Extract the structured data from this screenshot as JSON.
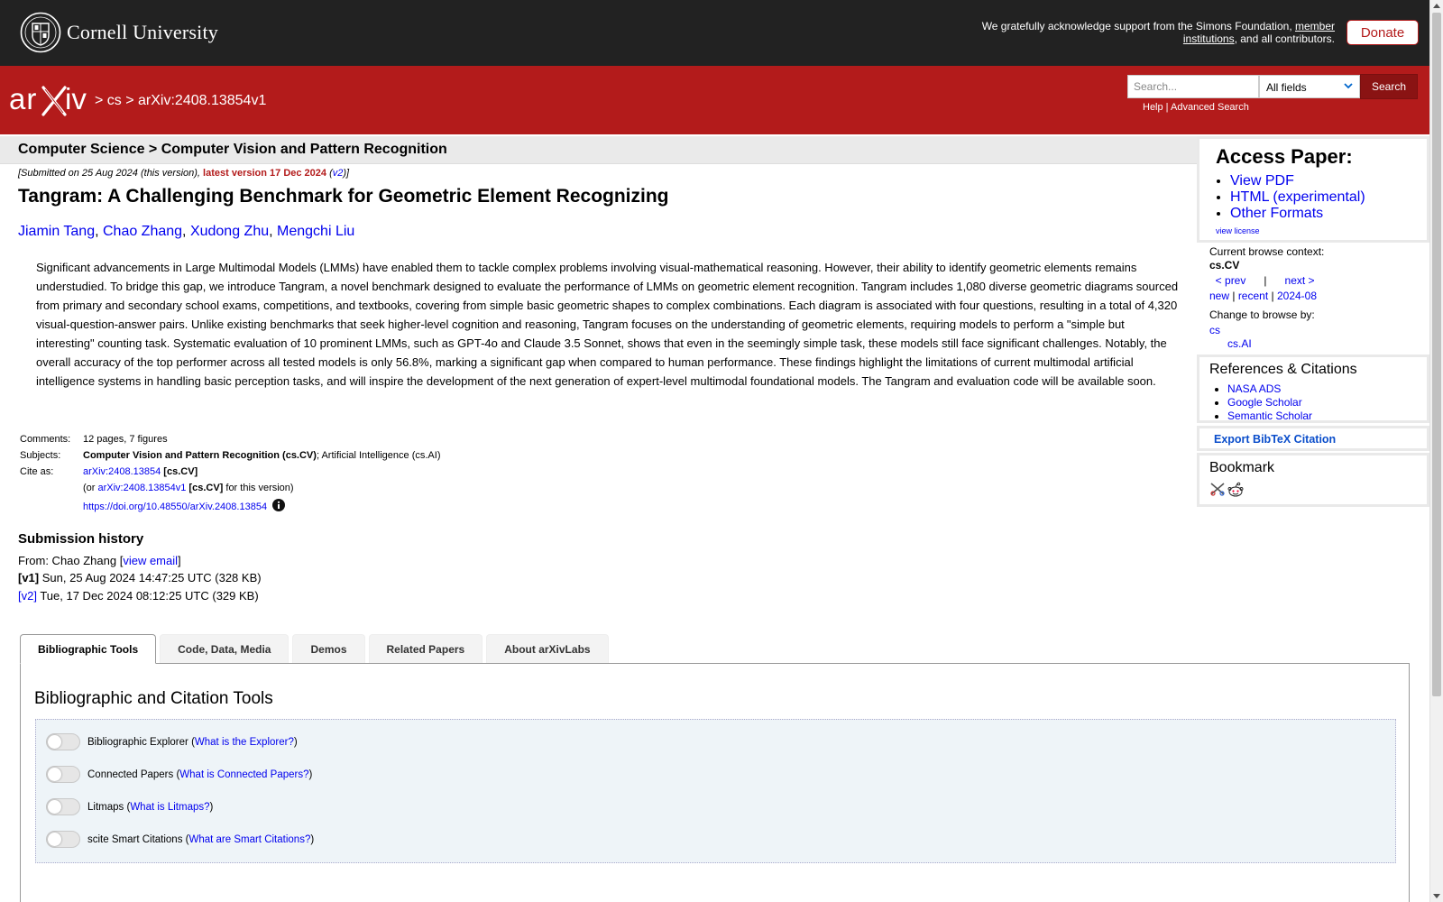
{
  "top": {
    "university": "Cornell University",
    "ack_prefix": "We gratefully acknowledge support from the Simons Foundation, ",
    "ack_link1": "member",
    "ack_link2": "institutions",
    "ack_suffix": ", and all contributors.",
    "donate": "Donate"
  },
  "header": {
    "crumbs": "> cs > arXiv:2408.13854v1",
    "search_placeholder": "Search...",
    "search_field": "All fields",
    "search_button": "Search",
    "help": "Help",
    "sep": " | ",
    "advanced": "Advanced Search"
  },
  "subject_header": "Computer Science > Computer Vision and Pattern Recognition",
  "paper": {
    "submitted_prefix": "[Submitted on 25 Aug 2024 (this version), ",
    "latest": "latest version 17 Dec 2024",
    "v2_open": " (",
    "v2": "v2",
    "v2_close": ")]",
    "title": "Tangram: A Challenging Benchmark for Geometric Element Recognizing",
    "authors": [
      "Jiamin Tang",
      "Chao Zhang",
      "Xudong Zhu",
      "Mengchi Liu"
    ],
    "abstract": "Significant advancements in Large Multimodal Models (LMMs) have enabled them to tackle complex problems involving visual-mathematical reasoning. However, their ability to identify geometric elements remains understudied. To bridge this gap, we introduce Tangram, a novel benchmark designed to evaluate the performance of LMMs on geometric element recognition. Tangram includes 1,080 diverse geometric diagrams sourced from primary and secondary school exams, competitions, and textbooks, covering from simple basic geometric shapes to complex combinations. Each diagram is associated with four questions, resulting in a total of 4,320 visual-question-answer pairs. Unlike existing benchmarks that seek higher-level cognition and reasoning, Tangram focuses on the understanding of geometric elements, requiring models to perform a \"simple but interesting\" counting task. Systematic evaluation of 10 prominent LMMs, such as GPT-4o and Claude 3.5 Sonnet, shows that even in the seemingly simple task, these models still face significant challenges. Notably, the overall accuracy of the top performer across all tested models is only 56.8%, marking a significant gap when compared to human performance. These findings highlight the limitations of current multimodal artificial intelligence systems in handling basic perception tasks, and will inspire the development of the next generation of expert-level multimodal foundational models. The Tangram and evaluation code will be available soon."
  },
  "meta": {
    "comments_label": "Comments:",
    "comments": "12 pages, 7 figures",
    "subjects_label": "Subjects:",
    "subject_primary": "Computer Vision and Pattern Recognition (cs.CV)",
    "subject_rest": "; Artificial Intelligence (cs.AI)",
    "cite_label": "Cite as:",
    "cite_id": "arXiv:2408.13854",
    "cite_cat": " [cs.CV]",
    "or_prefix": "(or ",
    "version_id": "arXiv:2408.13854v1",
    "version_cat": " [cs.CV]",
    "version_suffix": " for this version)",
    "doi": "https://doi.org/10.48550/arXiv.2408.13854"
  },
  "history": {
    "heading": "Submission history",
    "from_prefix": "From: Chao Zhang [",
    "view_email": "view email",
    "from_suffix": "]",
    "v1_label": "[v1]",
    "v1_text": " Sun, 25 Aug 2024 14:47:25 UTC (328 KB)",
    "v2_label": "[v2]",
    "v2_text": " Tue, 17 Dec 2024 08:12:25 UTC (329 KB)"
  },
  "tabs": [
    "Bibliographic Tools",
    "Code, Data, Media",
    "Demos",
    "Related Papers",
    "About arXivLabs"
  ],
  "tools": {
    "heading": "Bibliographic and Citation Tools",
    "items": [
      {
        "name": "Bibliographic Explorer",
        "link": "What is the Explorer?"
      },
      {
        "name": "Connected Papers",
        "link": "What is Connected Papers?"
      },
      {
        "name": "Litmaps",
        "link": "What is Litmaps?"
      },
      {
        "name": "scite Smart Citations",
        "link": "What are Smart Citations?"
      }
    ]
  },
  "sidebar": {
    "access_heading": "Access Paper:",
    "access_links": [
      "View PDF",
      "HTML (experimental)",
      "Other Formats"
    ],
    "view_license": "view license",
    "context_label": "Current browse context:",
    "context_value": "cs.CV",
    "prev": "< prev",
    "pipe": "|",
    "next": "next >",
    "new": "new",
    "recent": "recent",
    "month": "2024-08",
    "change_label": "Change to browse by:",
    "browse_cs": "cs",
    "browse_csai": "cs.AI",
    "refs_heading": "References & Citations",
    "refs": [
      "NASA ADS",
      "Google Scholar",
      "Semantic Scholar"
    ],
    "export": "Export BibTeX Citation",
    "bookmark_heading": "Bookmark"
  }
}
